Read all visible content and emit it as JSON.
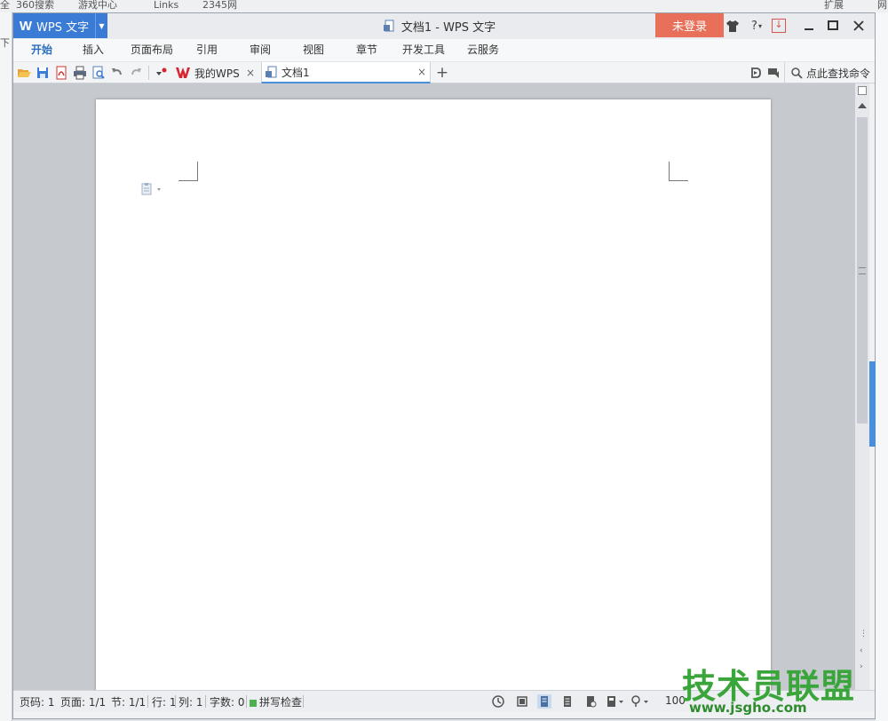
{
  "browser_bar": {
    "bookmarks": [
      "全",
      "360搜索",
      "游戏中心",
      "Links",
      "2345网",
      "扩展",
      "网"
    ],
    "left_fragment": "下"
  },
  "app": {
    "name": "WPS 文字",
    "window_title": "文档1 - WPS 文字",
    "login_label": "未登录",
    "help_label": "?",
    "brand_color": "#3a7bd5",
    "login_color": "#e8705a"
  },
  "ribbon": {
    "tabs": [
      {
        "label": "开始",
        "active": true
      },
      {
        "label": "插入",
        "active": false
      },
      {
        "label": "页面布局",
        "active": false
      },
      {
        "label": "引用",
        "active": false
      },
      {
        "label": "审阅",
        "active": false
      },
      {
        "label": "视图",
        "active": false
      },
      {
        "label": "章节",
        "active": false
      },
      {
        "label": "开发工具",
        "active": false
      },
      {
        "label": "云服务",
        "active": false
      }
    ]
  },
  "doc_tabs": {
    "mywps_label": "我的WPS",
    "doc1_label": "文档1",
    "close_glyph": "×",
    "new_tab_glyph": "+"
  },
  "command_search": {
    "placeholder": "点此查找命令"
  },
  "status_bar": {
    "page_num": "页码: 1",
    "page_count": "页面: 1/1",
    "section": "节: 1/1",
    "row": "行: 1",
    "column": "列: 1",
    "word_count": "字数: 0",
    "spell_check": "拼写检查",
    "zoom": "100"
  },
  "watermark": {
    "title": "技术员联盟",
    "url": "www.jsgho.com"
  }
}
